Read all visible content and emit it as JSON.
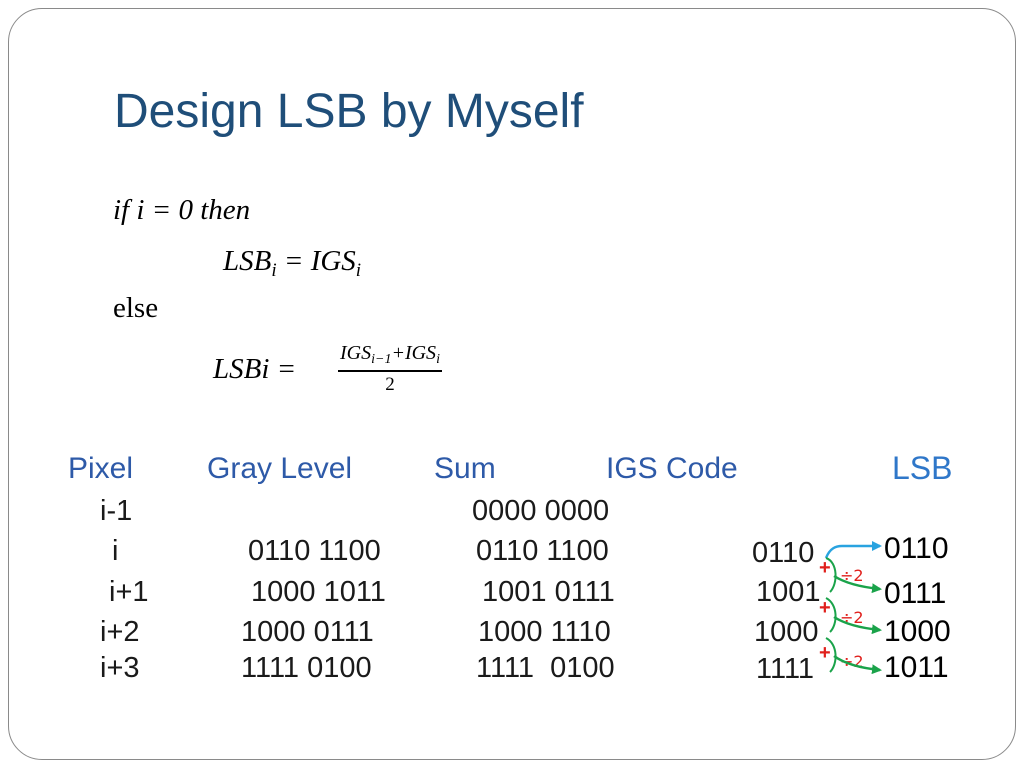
{
  "slide": {
    "title": "Design LSB by Myself",
    "formula": {
      "line1": "if i = 0 then",
      "line2_lhs": "LSB",
      "line2_sub": "i",
      "line2_eq": " = IGS",
      "line2_sub2": "i",
      "line3": "else",
      "line4_lhs": "LSBi =",
      "frac_num_a": "IGS",
      "frac_num_a_sub": "i−1",
      "frac_num_plus": "+IGS",
      "frac_num_b_sub": "i",
      "frac_den": "2"
    }
  },
  "table": {
    "headers": {
      "pixel": "Pixel",
      "gray": "Gray Level",
      "sum": "Sum",
      "igs": "IGS Code",
      "lsb": "LSB"
    },
    "rows": [
      {
        "pixel": "i-1",
        "gray": "",
        "sum": "0000 0000",
        "igs": "",
        "lsb": ""
      },
      {
        "pixel": "i",
        "gray": "0110 1100",
        "sum": "0110 1100",
        "igs": "0110",
        "lsb": "0110"
      },
      {
        "pixel": "i+1",
        "gray": "1000 1011",
        "sum": "1001 0111",
        "igs": "1001",
        "lsb": "0111"
      },
      {
        "pixel": "i+2",
        "gray": "1000 0111",
        "sum": "1000 1110",
        "igs": "1000",
        "lsb": "1000"
      },
      {
        "pixel": "i+3",
        "gray": "1111 0100",
        "sum": "1111  0100",
        "igs": "1111",
        "lsb": "1011"
      }
    ],
    "operators": {
      "plus": "+",
      "divide": "÷2"
    }
  },
  "colors": {
    "title": "#1f4e79",
    "header": "#2e5aa8",
    "lsb_header": "#2f77c9",
    "operator": "#e0201c",
    "arrow_green": "#1aa34a",
    "arrow_blue": "#29a3e0"
  }
}
